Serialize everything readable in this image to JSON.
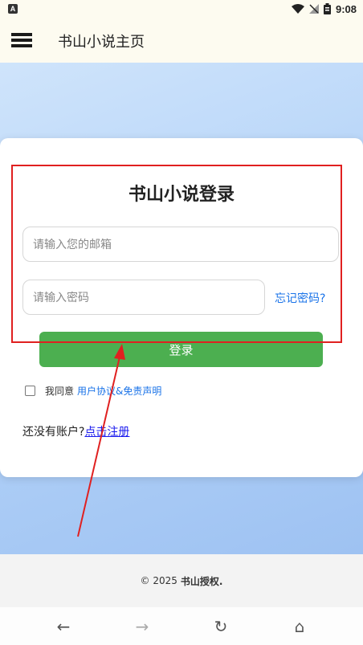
{
  "status_bar": {
    "time": "9:08",
    "notification_glyph": "A",
    "icons": [
      "wifi-icon",
      "no-signal-icon",
      "battery-icon"
    ]
  },
  "app_bar": {
    "title": "书山小说主页",
    "menu_icon": "hamburger-menu-icon"
  },
  "login": {
    "title": "书山小说登录",
    "email_placeholder": "请输入您的邮箱",
    "password_placeholder": "请输入密码",
    "forgot_password": "忘记密码?",
    "login_button": "登录",
    "agree_prefix": "我同意",
    "agree_link": "用户协议&免责声明",
    "agree_checked": false,
    "register_prompt": "还没有账户?",
    "register_link": "点击注册"
  },
  "footer": {
    "copyright": "© 2025",
    "owner": "书山授权."
  },
  "nav": {
    "back": "←",
    "forward": "→",
    "reload": "↻",
    "home": "⌂"
  },
  "colors": {
    "accent_green": "#4caf50",
    "link_blue": "#1a73e8",
    "annotation_red": "#e02020"
  }
}
